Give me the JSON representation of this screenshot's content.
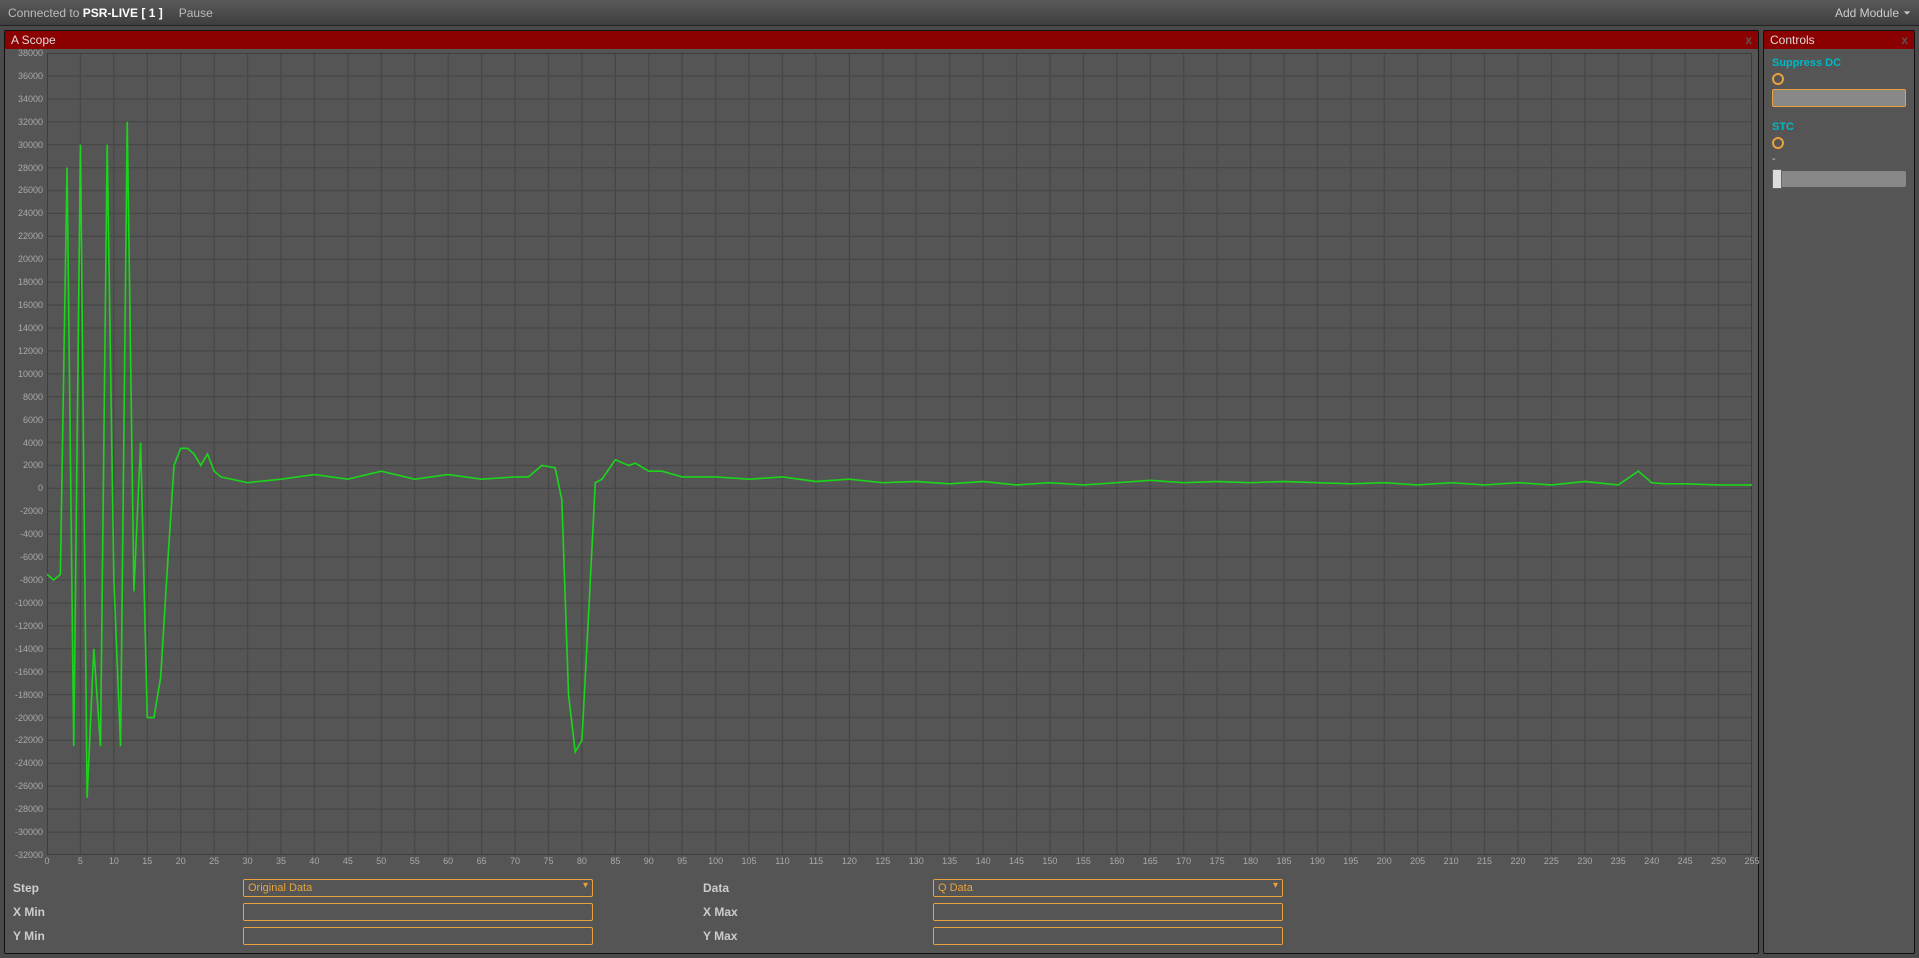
{
  "topbar": {
    "connected_prefix": "Connected to ",
    "connected_target": "PSR-LIVE [ 1 ]",
    "pause": "Pause",
    "add_module": "Add Module"
  },
  "scope": {
    "title": "A Scope",
    "close": "x",
    "form": {
      "step_label": "Step",
      "step_value": "Original Data",
      "data_label": "Data",
      "data_value": "Q Data",
      "xmin_label": "X Min",
      "xmin_value": "",
      "xmax_label": "X Max",
      "xmax_value": "",
      "ymin_label": "Y Min",
      "ymin_value": "",
      "ymax_label": "Y Max",
      "ymax_value": ""
    }
  },
  "controls": {
    "title": "Controls",
    "close": "x",
    "suppress_label": "Suppress DC",
    "suppress_value": "",
    "stc_label": "STC",
    "stc_dash": "-"
  },
  "chart_data": {
    "type": "line",
    "xlabel": "",
    "ylabel": "",
    "xlim": [
      0,
      255
    ],
    "ylim": [
      -32000,
      38000
    ],
    "x_ticks": [
      0,
      5,
      10,
      15,
      20,
      25,
      30,
      35,
      40,
      45,
      50,
      55,
      60,
      65,
      70,
      75,
      80,
      85,
      90,
      95,
      100,
      105,
      110,
      115,
      120,
      125,
      130,
      135,
      140,
      145,
      150,
      155,
      160,
      165,
      170,
      175,
      180,
      185,
      190,
      195,
      200,
      205,
      210,
      215,
      220,
      225,
      230,
      235,
      240,
      245,
      250,
      255
    ],
    "y_ticks": [
      38000,
      36000,
      34000,
      32000,
      30000,
      28000,
      26000,
      24000,
      22000,
      20000,
      18000,
      16000,
      14000,
      12000,
      10000,
      8000,
      6000,
      4000,
      2000,
      0,
      -2000,
      -4000,
      -6000,
      -8000,
      -10000,
      -12000,
      -14000,
      -16000,
      -18000,
      -20000,
      -22000,
      -24000,
      -26000,
      -28000,
      -30000,
      -32000
    ],
    "series": [
      {
        "name": "Q Data",
        "color": "#1bd41b",
        "x": [
          0,
          1,
          2,
          3,
          4,
          5,
          6,
          7,
          8,
          9,
          10,
          11,
          12,
          13,
          14,
          15,
          16,
          17,
          18,
          19,
          20,
          21,
          22,
          23,
          24,
          25,
          26,
          30,
          35,
          40,
          45,
          50,
          55,
          60,
          65,
          70,
          72,
          74,
          76,
          77,
          78,
          79,
          80,
          81,
          82,
          83,
          85,
          87,
          88,
          90,
          92,
          95,
          100,
          105,
          110,
          115,
          120,
          125,
          130,
          135,
          140,
          145,
          150,
          155,
          160,
          165,
          170,
          175,
          180,
          185,
          190,
          195,
          200,
          205,
          210,
          215,
          220,
          225,
          230,
          235,
          238,
          240,
          242,
          245,
          250,
          255
        ],
        "y": [
          -7500,
          -8000,
          -7500,
          28000,
          -22500,
          30000,
          -27000,
          -14000,
          -22500,
          30000,
          -8000,
          -22500,
          32000,
          -9000,
          4000,
          -20000,
          -20000,
          -16500,
          -7000,
          2000,
          3500,
          3500,
          3000,
          2000,
          3000,
          1500,
          1000,
          500,
          800,
          1200,
          800,
          1500,
          800,
          1200,
          800,
          1000,
          1000,
          2000,
          1800,
          -1000,
          -18000,
          -23000,
          -22000,
          -11000,
          500,
          800,
          2500,
          2000,
          2200,
          1500,
          1500,
          1000,
          1000,
          800,
          1000,
          600,
          800,
          500,
          600,
          400,
          600,
          300,
          500,
          300,
          500,
          700,
          500,
          600,
          500,
          600,
          500,
          400,
          500,
          300,
          500,
          300,
          500,
          300,
          600,
          300,
          1500,
          500,
          400,
          400,
          300,
          300
        ]
      }
    ]
  }
}
